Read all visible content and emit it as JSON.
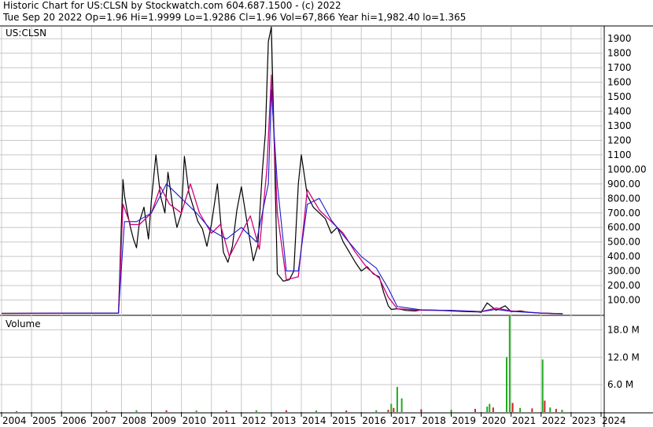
{
  "header": {
    "line1": "Historic Chart for US:CLSN by Stockwatch.com 604.687.1500 - (c) 2022",
    "line2": "Tue Sep 20 2022   Op=1.96   Hi=1.9999   Lo=1.9286   Cl=1.96   Vol=67,866   Year hi=1,982.40   lo=1.365"
  },
  "colors": {
    "price": "#000000",
    "ma_short": "#d0007a",
    "ma_long": "#1a1acc",
    "vol_up": "#22aa22",
    "vol_down": "#cc2222",
    "grid": "#c8c8c8"
  },
  "chart_data": [
    {
      "type": "line",
      "label": "US:CLSN",
      "ylim": [
        0,
        1982.4
      ],
      "y_ticks": [
        "100.00",
        "200.00",
        "300.00",
        "400.00",
        "500.00",
        "600.00",
        "700.00",
        "800.00",
        "900.00",
        "1000.00",
        "1100",
        "1200",
        "1300",
        "1400",
        "1500",
        "1600",
        "1700",
        "1800",
        "1900"
      ],
      "y_tick_values": [
        100,
        200,
        300,
        400,
        500,
        600,
        700,
        800,
        900,
        1000,
        1100,
        1200,
        1300,
        1400,
        1500,
        1600,
        1700,
        1800,
        1900
      ],
      "x_ticks": [
        "2004",
        "2005",
        "2006",
        "2007",
        "2008",
        "2009",
        "2010",
        "2011",
        "2012",
        "2013",
        "2014",
        "2015",
        "2016",
        "2017",
        "2018",
        "2019",
        "2020",
        "2021",
        "2022",
        "2023",
        "2024"
      ],
      "series": [
        {
          "x": [
            2004.0,
            2006.0,
            2007.9,
            2008.0,
            2008.05,
            2008.1,
            2008.2,
            2008.3,
            2008.4,
            2008.5,
            2008.6,
            2008.75,
            2008.9,
            2009.0,
            2009.15,
            2009.3,
            2009.45,
            2009.55,
            2009.7,
            2009.85,
            2010.0,
            2010.1,
            2010.25,
            2010.4,
            2010.55,
            2010.7,
            2010.85,
            2011.0,
            2011.2,
            2011.4,
            2011.55,
            2011.7,
            2011.85,
            2012.0,
            2012.2,
            2012.4,
            2012.55,
            2012.7,
            2012.8,
            2012.9,
            2013.0,
            2013.1,
            2013.2,
            2013.4,
            2013.6,
            2013.75,
            2013.9,
            2014.0,
            2014.2,
            2014.4,
            2014.6,
            2014.8,
            2015.0,
            2015.2,
            2015.4,
            2015.6,
            2015.8,
            2016.0,
            2016.2,
            2016.4,
            2016.6,
            2016.75,
            2016.9,
            2017.0,
            2017.2,
            2017.5,
            2017.8,
            2018.0,
            2018.5,
            2019.0,
            2019.5,
            2019.9,
            2020.0,
            2020.2,
            2020.5,
            2020.8,
            2021.0,
            2021.3,
            2021.6,
            2022.0,
            2022.3,
            2022.72
          ],
          "values": [
            8,
            9,
            10,
            640,
            930,
            820,
            700,
            600,
            520,
            460,
            640,
            740,
            520,
            790,
            1100,
            820,
            700,
            980,
            760,
            600,
            700,
            1090,
            840,
            740,
            640,
            590,
            470,
            620,
            900,
            430,
            360,
            470,
            720,
            880,
            620,
            370,
            480,
            990,
            1250,
            1880,
            1980,
            1150,
            280,
            230,
            240,
            300,
            900,
            1100,
            820,
            740,
            700,
            660,
            560,
            600,
            500,
            430,
            360,
            300,
            330,
            280,
            260,
            150,
            60,
            35,
            40,
            28,
            25,
            32,
            30,
            25,
            20,
            18,
            15,
            80,
            30,
            60,
            20,
            25,
            15,
            10,
            8,
            5
          ]
        },
        {
          "name": "",
          "x": [
            2004.0,
            2006.0,
            2007.9,
            2008.05,
            2008.3,
            2008.6,
            2009.0,
            2009.3,
            2009.6,
            2010.0,
            2010.3,
            2010.6,
            2011.0,
            2011.3,
            2011.6,
            2012.0,
            2012.3,
            2012.6,
            2012.85,
            2013.0,
            2013.2,
            2013.5,
            2013.9,
            2014.2,
            2014.6,
            2015.0,
            2015.4,
            2015.8,
            2016.2,
            2016.6,
            2016.9,
            2017.2,
            2018.0,
            2019.0,
            2020.0,
            2020.5,
            2021.0,
            2022.0,
            2022.72
          ],
          "values": [
            8,
            9,
            10,
            760,
            620,
            620,
            700,
            880,
            760,
            700,
            900,
            700,
            560,
            620,
            400,
            560,
            680,
            450,
            1000,
            1650,
            700,
            240,
            260,
            860,
            720,
            640,
            560,
            430,
            320,
            250,
            120,
            40,
            30,
            28,
            20,
            45,
            25,
            10,
            6
          ]
        },
        {
          "name": "",
          "x": [
            2004.0,
            2006.0,
            2007.9,
            2008.1,
            2008.5,
            2009.0,
            2009.5,
            2010.0,
            2010.5,
            2011.0,
            2011.5,
            2012.0,
            2012.5,
            2012.9,
            2013.0,
            2013.2,
            2013.5,
            2013.9,
            2014.2,
            2014.6,
            2015.0,
            2015.5,
            2016.0,
            2016.5,
            2016.9,
            2017.2,
            2018.0,
            2019.0,
            2020.0,
            2020.5,
            2021.0,
            2022.0,
            2022.72
          ],
          "values": [
            8,
            9,
            10,
            640,
            640,
            700,
            900,
            800,
            700,
            580,
            520,
            600,
            500,
            900,
            1550,
            900,
            300,
            300,
            760,
            800,
            650,
            520,
            400,
            320,
            180,
            55,
            32,
            28,
            20,
            35,
            22,
            10,
            6
          ]
        }
      ]
    },
    {
      "type": "bar",
      "label": "Volume",
      "ylim": [
        0,
        21000000
      ],
      "y_ticks": [
        "6.0 M",
        "12.0 M",
        "18.0 M"
      ],
      "y_tick_values": [
        6000000,
        12000000,
        18000000
      ],
      "x": [
        2004.5,
        2006.0,
        2007.5,
        2008.5,
        2009.5,
        2010.5,
        2011.5,
        2012.5,
        2013.5,
        2014.5,
        2015.5,
        2016.5,
        2016.9,
        2017.0,
        2017.08,
        2017.2,
        2017.35,
        2018.0,
        2019.0,
        2019.8,
        2020.2,
        2020.28,
        2020.4,
        2020.85,
        2020.95,
        2021.05,
        2021.3,
        2021.7,
        2022.05,
        2022.12,
        2022.3,
        2022.5,
        2022.7
      ],
      "values": [
        200000,
        200000,
        300000,
        400000,
        400000,
        350000,
        350000,
        400000,
        400000,
        350000,
        350000,
        400000,
        500000,
        1800000,
        900000,
        5500000,
        3000000,
        600000,
        500000,
        700000,
        1200000,
        1800000,
        1000000,
        12000000,
        21000000,
        2000000,
        900000,
        800000,
        11500000,
        2500000,
        1000000,
        700000,
        500000
      ],
      "up": [
        false,
        true,
        false,
        true,
        false,
        true,
        false,
        true,
        false,
        true,
        false,
        true,
        false,
        true,
        false,
        true,
        true,
        false,
        true,
        false,
        true,
        true,
        false,
        true,
        true,
        false,
        true,
        false,
        true,
        false,
        true,
        false,
        true
      ]
    }
  ]
}
